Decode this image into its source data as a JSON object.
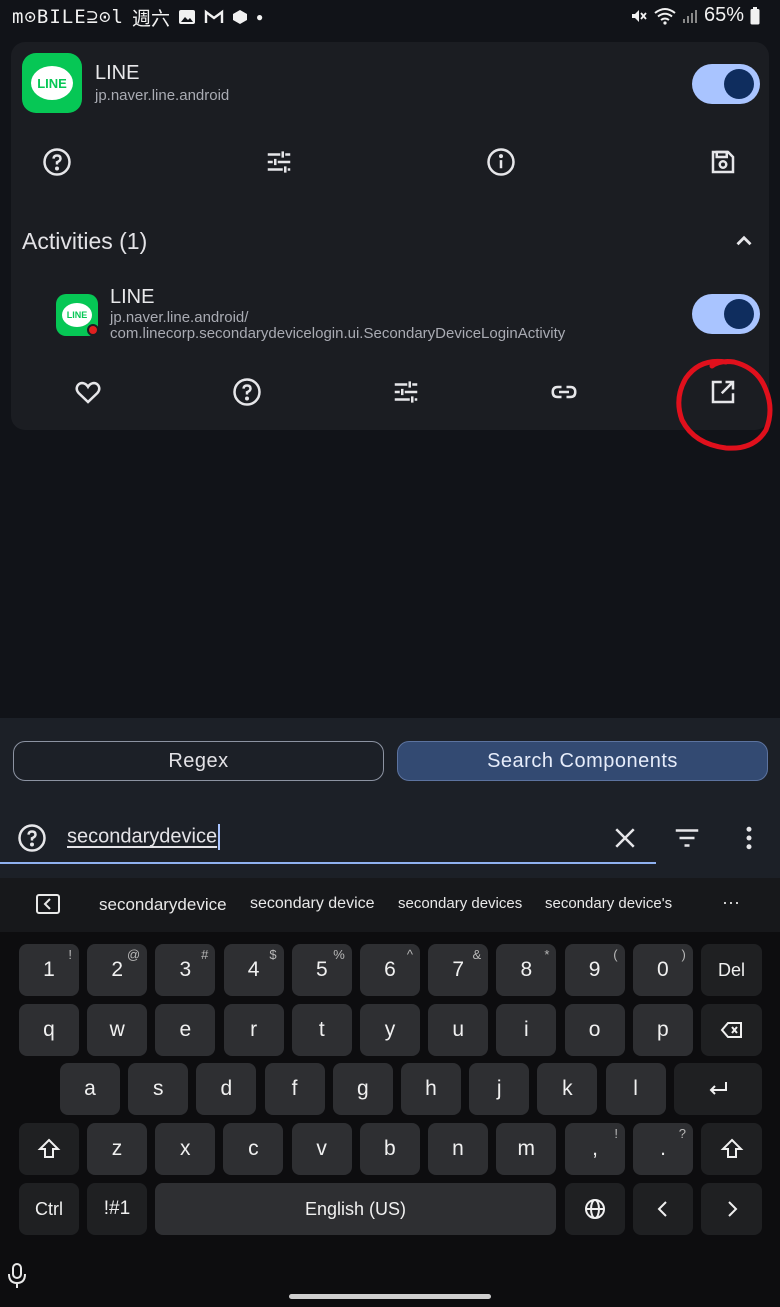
{
  "status_bar": {
    "brand": "m⊙BILE⊇⊙l",
    "day": "週六",
    "battery": "65%"
  },
  "app": {
    "name": "LINE",
    "package": "jp.naver.line.android",
    "icon_label": "LINE",
    "enabled": true
  },
  "activities": {
    "title": "Activities (1)",
    "items": [
      {
        "name": "LINE",
        "component_line1": "jp.naver.line.android/",
        "component_line2": "com.linecorp.secondarydevicelogin.ui.SecondaryDeviceLoginActivity",
        "icon_label": "LINE",
        "enabled": true
      }
    ]
  },
  "filters": {
    "regex_label": "Regex",
    "search_components_label": "Search Components"
  },
  "search": {
    "value": "secondarydevice"
  },
  "keyboard": {
    "suggestions": [
      "secondarydevice",
      "secondary device",
      "secondary devices",
      "secondary device's"
    ],
    "more": "···",
    "row_numbers": [
      {
        "k": "1",
        "s": "!"
      },
      {
        "k": "2",
        "s": "@"
      },
      {
        "k": "3",
        "s": "#"
      },
      {
        "k": "4",
        "s": "$"
      },
      {
        "k": "5",
        "s": "%"
      },
      {
        "k": "6",
        "s": "^"
      },
      {
        "k": "7",
        "s": "&"
      },
      {
        "k": "8",
        "s": "*"
      },
      {
        "k": "9",
        "s": "("
      },
      {
        "k": "0",
        "s": ")"
      }
    ],
    "del": "Del",
    "row_q": [
      "q",
      "w",
      "e",
      "r",
      "t",
      "y",
      "u",
      "i",
      "o",
      "p"
    ],
    "row_a": [
      "a",
      "s",
      "d",
      "f",
      "g",
      "h",
      "j",
      "k",
      "l"
    ],
    "row_z": [
      "z",
      "x",
      "c",
      "v",
      "b",
      "n",
      "m"
    ],
    "comma": {
      "k": ",",
      "s": "!"
    },
    "period": {
      "k": ".",
      "s": "?"
    },
    "ctrl": "Ctrl",
    "symbols": "!#1",
    "space": "English (US)"
  },
  "colors": {
    "accent": "#a9c4ff",
    "line_green": "#06c755",
    "annotation_red": "#e0101c"
  }
}
